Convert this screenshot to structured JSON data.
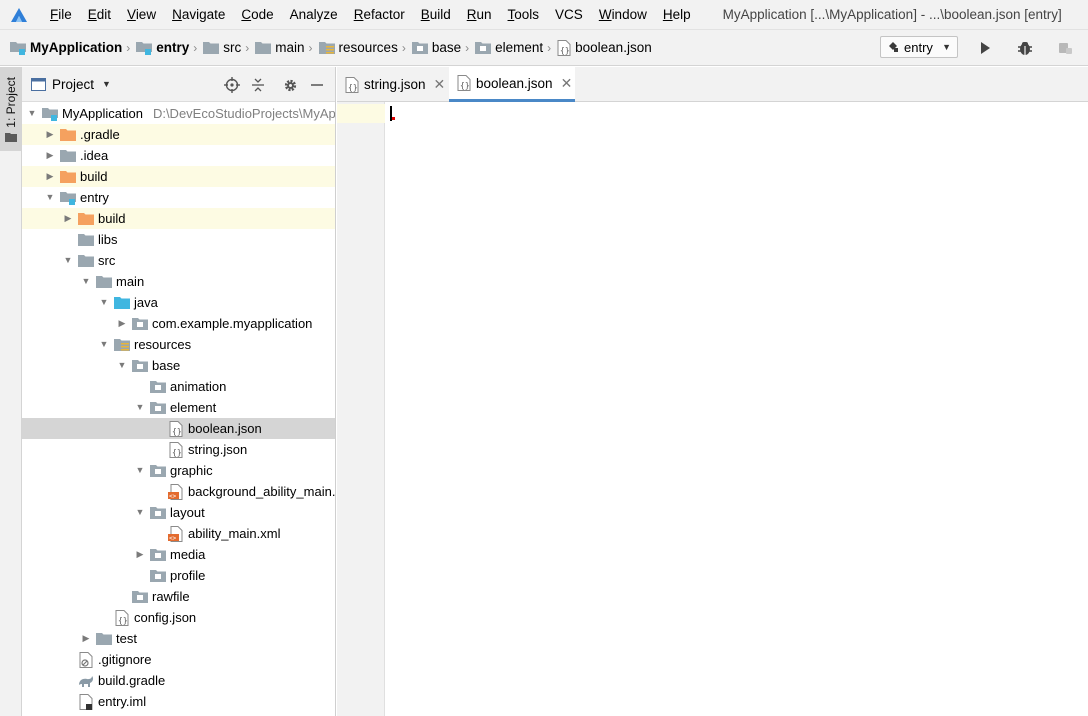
{
  "menu": {
    "items": [
      {
        "mnemonic": "F",
        "rest": "ile"
      },
      {
        "mnemonic": "E",
        "rest": "dit"
      },
      {
        "mnemonic": "V",
        "rest": "iew"
      },
      {
        "mnemonic": "N",
        "rest": "avigate"
      },
      {
        "mnemonic": "C",
        "rest": "ode"
      },
      {
        "mnemonic": "",
        "rest": "Analyze"
      },
      {
        "mnemonic": "R",
        "rest": "efactor"
      },
      {
        "mnemonic": "B",
        "rest": "uild"
      },
      {
        "mnemonic": "R",
        "rest": "un"
      },
      {
        "mnemonic": "T",
        "rest": "ools"
      },
      {
        "mnemonic": "",
        "rest": "VCS"
      },
      {
        "mnemonic": "W",
        "rest": "indow"
      },
      {
        "mnemonic": "H",
        "rest": "elp"
      }
    ],
    "window_title": "MyApplication [...\\MyApplication] - ...\\boolean.json [entry]"
  },
  "breadcrumb": [
    "MyApplication",
    "entry",
    "src",
    "main",
    "resources",
    "base",
    "element",
    "boolean.json"
  ],
  "run_config": {
    "label": "entry"
  },
  "tool_stripe": {
    "project_label": "1: Project"
  },
  "project_panel": {
    "title": "Project",
    "root_path": "D:\\DevEcoStudioProjects\\MyAp"
  },
  "tree": [
    {
      "label": "MyApplication",
      "depth": 0,
      "arrow": "down",
      "icon": "module-folder-icon"
    },
    {
      "label": ".gradle",
      "depth": 1,
      "arrow": "right",
      "icon": "orange-folder-icon",
      "highlight": true
    },
    {
      "label": ".idea",
      "depth": 1,
      "arrow": "right",
      "icon": "folder-icon"
    },
    {
      "label": "build",
      "depth": 1,
      "arrow": "right",
      "icon": "orange-folder-icon",
      "highlight": true
    },
    {
      "label": "entry",
      "depth": 1,
      "arrow": "down",
      "icon": "module-folder-icon"
    },
    {
      "label": "build",
      "depth": 2,
      "arrow": "right",
      "icon": "orange-folder-icon",
      "highlight": true
    },
    {
      "label": "libs",
      "depth": 2,
      "arrow": "none",
      "icon": "folder-icon"
    },
    {
      "label": "src",
      "depth": 2,
      "arrow": "down",
      "icon": "folder-icon"
    },
    {
      "label": "main",
      "depth": 3,
      "arrow": "down",
      "icon": "folder-icon"
    },
    {
      "label": "java",
      "depth": 4,
      "arrow": "down",
      "icon": "blue-folder-icon"
    },
    {
      "label": "com.example.myapplication",
      "depth": 5,
      "arrow": "right",
      "icon": "package-icon"
    },
    {
      "label": "resources",
      "depth": 4,
      "arrow": "down",
      "icon": "resources-folder-icon"
    },
    {
      "label": "base",
      "depth": 5,
      "arrow": "down",
      "icon": "package-icon"
    },
    {
      "label": "animation",
      "depth": 6,
      "arrow": "none",
      "icon": "package-icon"
    },
    {
      "label": "element",
      "depth": 6,
      "arrow": "down",
      "icon": "package-icon"
    },
    {
      "label": "boolean.json",
      "depth": 7,
      "arrow": "none",
      "icon": "json-file-icon",
      "selected": true
    },
    {
      "label": "string.json",
      "depth": 7,
      "arrow": "none",
      "icon": "json-file-icon"
    },
    {
      "label": "graphic",
      "depth": 6,
      "arrow": "down",
      "icon": "package-icon"
    },
    {
      "label": "background_ability_main.xml",
      "depth": 7,
      "arrow": "none",
      "icon": "xml-file-icon"
    },
    {
      "label": "layout",
      "depth": 6,
      "arrow": "down",
      "icon": "package-icon"
    },
    {
      "label": "ability_main.xml",
      "depth": 7,
      "arrow": "none",
      "icon": "xml-file-icon"
    },
    {
      "label": "media",
      "depth": 6,
      "arrow": "right",
      "icon": "package-icon"
    },
    {
      "label": "profile",
      "depth": 6,
      "arrow": "none",
      "icon": "package-icon"
    },
    {
      "label": "rawfile",
      "depth": 5,
      "arrow": "none",
      "icon": "package-icon"
    },
    {
      "label": "config.json",
      "depth": 4,
      "arrow": "none",
      "icon": "json-file-icon"
    },
    {
      "label": "test",
      "depth": 3,
      "arrow": "right",
      "icon": "folder-icon"
    },
    {
      "label": ".gitignore",
      "depth": 2,
      "arrow": "none",
      "icon": "ignore-file-icon"
    },
    {
      "label": "build.gradle",
      "depth": 2,
      "arrow": "none",
      "icon": "gradle-file-icon"
    },
    {
      "label": "entry.iml",
      "depth": 2,
      "arrow": "none",
      "icon": "iml-file-icon"
    }
  ],
  "editor": {
    "tabs": [
      {
        "label": "string.json",
        "active": false
      },
      {
        "label": "boolean.json",
        "active": true
      }
    ]
  },
  "colors": {
    "selection": "#d5d5d5",
    "excluded_highlight": "#fdfbe3",
    "folder_gray": "#9aa7b0",
    "folder_orange": "#f5a15f",
    "folder_blue": "#40b6e0",
    "active_tab_underline": "#4a88c7"
  }
}
